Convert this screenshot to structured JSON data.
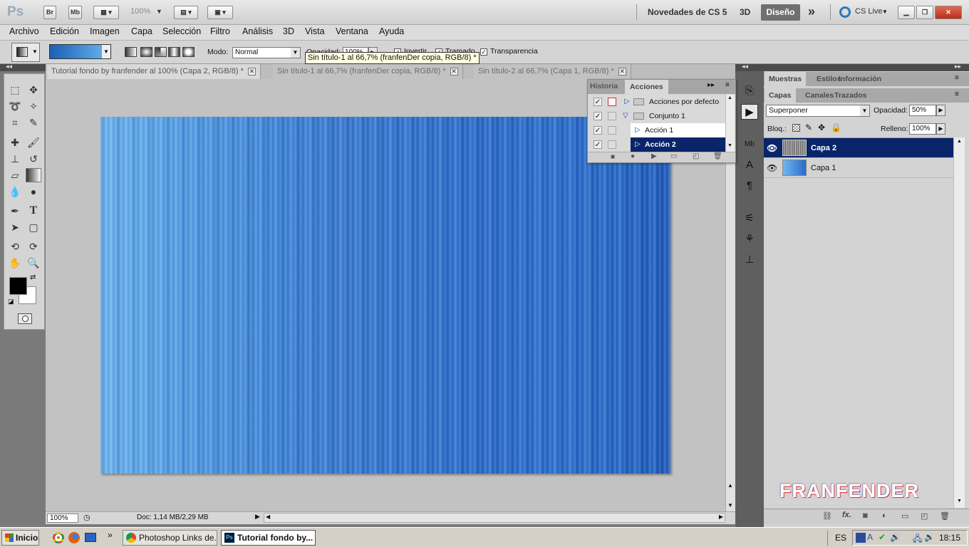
{
  "appbar": {
    "logo": "Ps",
    "bridge": "Br",
    "minibridge": "Mb",
    "zoom": "100%",
    "workspace_novedades": "Novedades de CS 5",
    "workspace_3d": "3D",
    "workspace_active": "Diseño",
    "cslive": "CS Live",
    "more": "»"
  },
  "menu": [
    "Archivo",
    "Edición",
    "Imagen",
    "Capa",
    "Selección",
    "Filtro",
    "Análisis",
    "3D",
    "Vista",
    "Ventana",
    "Ayuda"
  ],
  "options": {
    "mode_label": "Modo:",
    "mode_value": "Normal",
    "opacity_label": "Opacidad:",
    "opacity_value": "100%",
    "invert": "Invertir",
    "dither": "Tramado",
    "transparency": "Transparencia",
    "tooltip": "Sin título-1 al 66,7% (franfenDer copia, RGB/8) *"
  },
  "tabs": [
    {
      "label": "Tutorial fondo by franfender al 100% (Capa 2, RGB/8) *"
    },
    {
      "label": "Sin título-1 al 66,7% (franfenDer copia, RGB/8) *"
    },
    {
      "label": "Sin título-2 al 66,7% (Capa 1, RGB/8) *"
    }
  ],
  "status": {
    "zoom": "100%",
    "doc": "Doc: 1,14 MB/2,29 MB"
  },
  "actions_panel": {
    "tab_history": "Historia",
    "tab_actions": "Acciones",
    "rows": [
      {
        "label": "Acciones por defecto"
      },
      {
        "label": "Conjunto 1"
      },
      {
        "label": "Acción 1"
      },
      {
        "label": "Acción 2"
      }
    ]
  },
  "right_panel": {
    "tabs_top": [
      "Muestras",
      "Estilos",
      "Información"
    ],
    "tabs_layers": [
      "Capas",
      "Canales",
      "Trazados"
    ],
    "blend_mode": "Superponer",
    "opacity_label": "Opacidad:",
    "opacity_value": "50%",
    "lock_label": "Bloq.:",
    "fill_label": "Relleno:",
    "fill_value": "100%",
    "layers": [
      {
        "name": "Capa 2"
      },
      {
        "name": "Capa 1"
      }
    ],
    "watermark": "FRANFENDER"
  },
  "taskbar": {
    "start": "Inicio",
    "items": [
      "Photoshop Links de...",
      "Tutorial fondo by..."
    ],
    "lang": "ES",
    "clock": "18:15"
  },
  "colors": {
    "accent_selected": "#0a246a",
    "canvas_blue": "#2f7fd6"
  }
}
